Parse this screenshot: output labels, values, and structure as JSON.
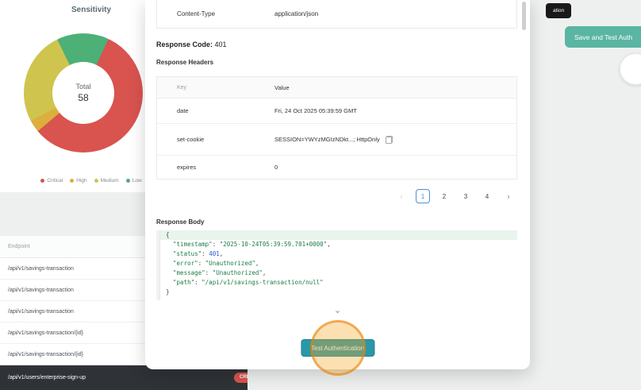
{
  "sensitivity_panel": {
    "title": "Sensitivity",
    "total_label": "Total",
    "total_value": "58",
    "legend": [
      {
        "label": "Critical",
        "color": "#d9534f"
      },
      {
        "label": "High",
        "color": "#dcaf3c"
      },
      {
        "label": "Medium",
        "color": "#cfc44e"
      },
      {
        "label": "Low",
        "color": "#4cb077"
      }
    ]
  },
  "chart_data": {
    "type": "pie",
    "title": "Sensitivity",
    "total": 58,
    "center_label": "Total",
    "categories": [
      "Critical",
      "High",
      "Medium",
      "Low"
    ],
    "values": [
      33,
      2,
      15,
      8
    ],
    "colors": [
      "#d9534f",
      "#dcaf3c",
      "#cfc44e",
      "#4cb077"
    ],
    "legend_position": "bottom",
    "gradient_stops": [
      {
        "color": "#4cb077",
        "from": 0,
        "to": 25
      },
      {
        "color": "#d9534f",
        "from": 25,
        "to": 230
      },
      {
        "color": "#dcaf3c",
        "from": 230,
        "to": 242
      },
      {
        "color": "#cfc44e",
        "from": 242,
        "to": 334
      },
      {
        "color": "#4cb077",
        "from": 334,
        "to": 360
      }
    ]
  },
  "endpoint_table": {
    "header": "Endpoint",
    "rows": [
      {
        "endpoint": "/api/v1/savings-transaction"
      },
      {
        "endpoint": "/api/v1/savings-transaction"
      },
      {
        "endpoint": "/api/v1/savings-transaction"
      },
      {
        "endpoint": "/api/v1/savings-transaction/{id}"
      },
      {
        "endpoint": "/api/v1/savings-transaction/{id}"
      },
      {
        "endpoint": "/api/v1/users/enterprise-sign-up",
        "badge": "CRITICAL"
      }
    ]
  },
  "modal": {
    "request_fragment": {
      "key": "Content-Type",
      "value": "application/json"
    },
    "response_code_label": "Response Code:",
    "response_code_value": "401",
    "response_headers_label": "Response Headers",
    "headers_table": {
      "columns": {
        "key": "Key",
        "value": "Value"
      },
      "rows": [
        {
          "key": "date",
          "value": "Fri, 24 Oct 2025 05:39:59 GMT"
        },
        {
          "key": "set-cookie",
          "value": "SESSION=YWYzMGIzNDkt...; HttpOnly"
        },
        {
          "key": "expires",
          "value": "0"
        }
      ]
    },
    "pagination": {
      "prev_icon": "‹",
      "pages": [
        "1",
        "2",
        "3",
        "4"
      ],
      "active": "1",
      "next_icon": "›"
    },
    "response_body_label": "Response Body",
    "code_lines": [
      "{",
      "  \"timestamp\": \"2025-10-24T05:39:59.701+0000\",",
      "  \"status\": 401,",
      "  \"error\": \"Unauthorized\",",
      "  \"message\": \"Unauthorized\",",
      "  \"path\": \"/api/v1/savings-transaction/null\"",
      "}"
    ],
    "expand_icon": "⌄",
    "test_auth_button": "Test Authentication"
  },
  "right_panel": {
    "dark_button_label": "ation",
    "save_button_label": "Save and Test Auth"
  }
}
